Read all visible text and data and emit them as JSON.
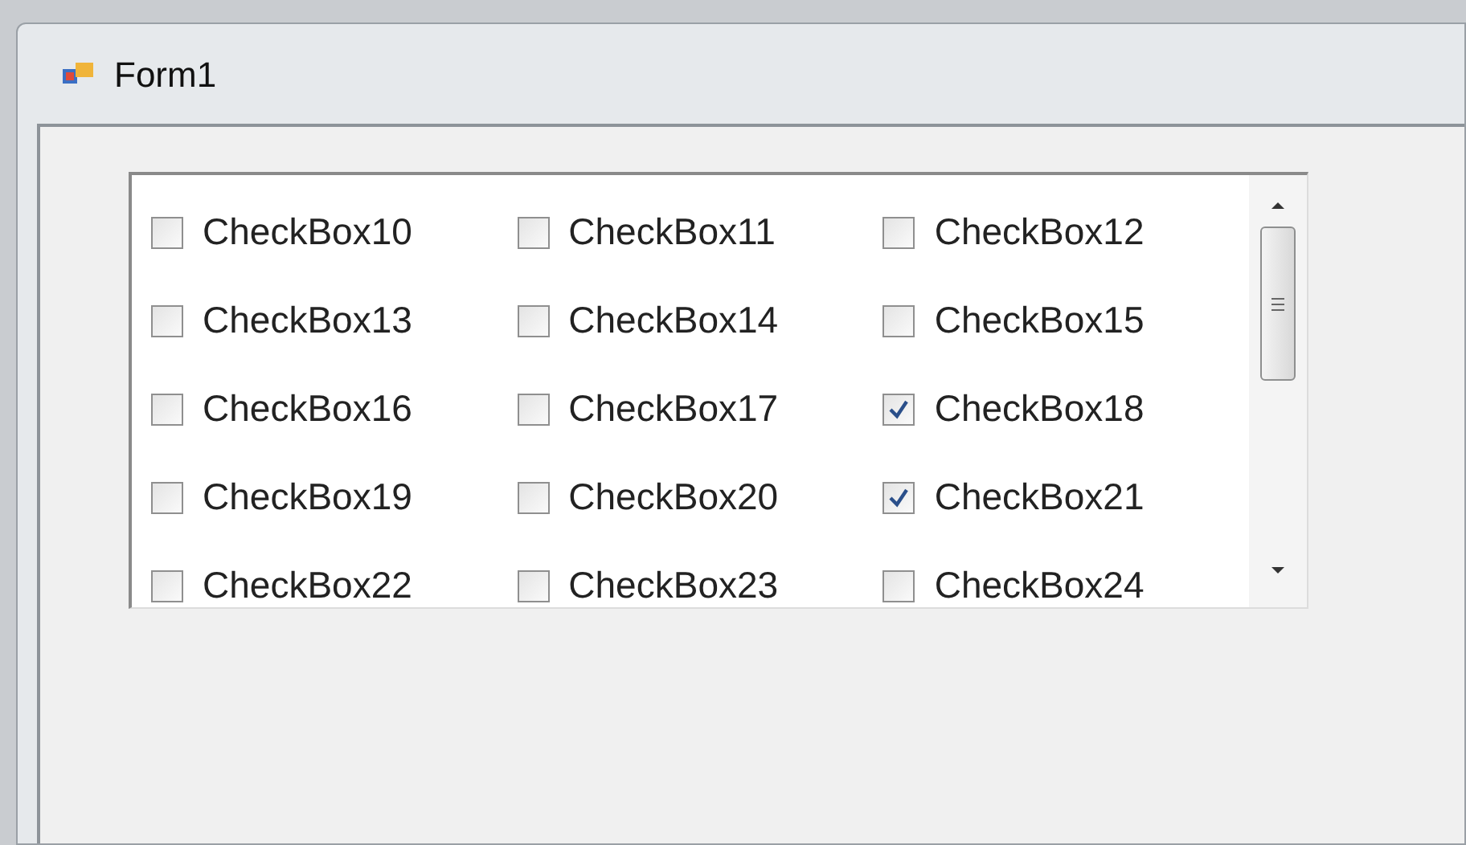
{
  "window": {
    "title": "Form1"
  },
  "checkboxes": [
    {
      "label": "CheckBox10",
      "checked": false
    },
    {
      "label": "CheckBox11",
      "checked": false
    },
    {
      "label": "CheckBox12",
      "checked": false
    },
    {
      "label": "CheckBox13",
      "checked": false
    },
    {
      "label": "CheckBox14",
      "checked": false
    },
    {
      "label": "CheckBox15",
      "checked": false
    },
    {
      "label": "CheckBox16",
      "checked": false
    },
    {
      "label": "CheckBox17",
      "checked": false
    },
    {
      "label": "CheckBox18",
      "checked": true
    },
    {
      "label": "CheckBox19",
      "checked": false
    },
    {
      "label": "CheckBox20",
      "checked": false
    },
    {
      "label": "CheckBox21",
      "checked": true
    },
    {
      "label": "CheckBox22",
      "checked": false
    },
    {
      "label": "CheckBox23",
      "checked": false
    },
    {
      "label": "CheckBox24",
      "checked": false
    }
  ]
}
